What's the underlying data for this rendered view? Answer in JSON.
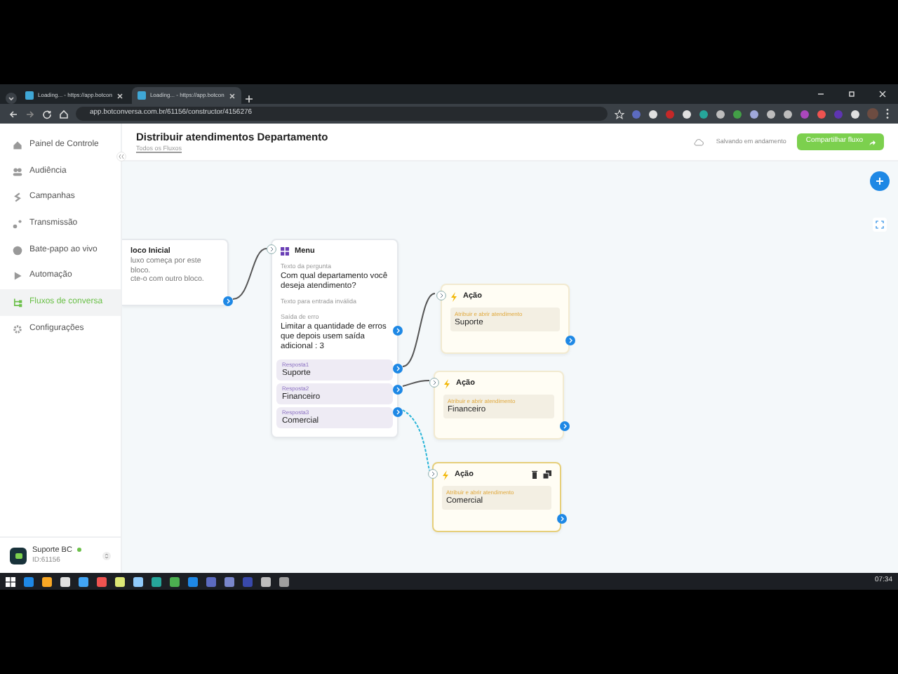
{
  "browser": {
    "tabs": [
      {
        "title": "Loading... - https://app.botcon",
        "selected": false
      },
      {
        "title": "Loading... - https://app.botcon",
        "selected": true
      }
    ],
    "url": "app.botconversa.com.br/61156/constructor/4156276"
  },
  "sidebar": {
    "items": [
      {
        "label": "Painel de Controle",
        "selected": false
      },
      {
        "label": "Audiência",
        "selected": false
      },
      {
        "label": "Campanhas",
        "selected": false
      },
      {
        "label": "Transmissão",
        "selected": false
      },
      {
        "label": "Bate-papo ao vivo",
        "selected": false
      },
      {
        "label": "Automação",
        "selected": false
      },
      {
        "label": "Fluxos de conversa",
        "selected": true
      },
      {
        "label": "Configurações",
        "selected": false
      }
    ],
    "account": {
      "name": "Suporte BC",
      "id": "ID:61156",
      "online": true
    }
  },
  "header": {
    "title": "Distribuir atendimentos Departamento",
    "breadcrumb": "Todos os Fluxos",
    "save_status": "Salvando em andamento",
    "share_button": "Compartilhar fluxo"
  },
  "canvas": {
    "nodes": [
      {
        "kind": "start",
        "title": "loco Inicial",
        "lines": [
          "luxo começa por este bloco.",
          "cte-o com outro bloco."
        ]
      },
      {
        "kind": "menu",
        "title": "Menu",
        "fields": [
          {
            "label": "Texto da pergunta",
            "value": "Com qual departamento você deseja atendimento?"
          },
          {
            "label": "Texto para entrada inválida"
          },
          {
            "label": "Saída de erro",
            "value": "Limitar a quantidade de erros que depois usem saída adicional : 3"
          }
        ],
        "answers": [
          {
            "label": "Resposta1",
            "value": "Suporte"
          },
          {
            "label": "Resposta2",
            "value": "Financeiro"
          },
          {
            "label": "Resposta3",
            "value": "Comercial"
          }
        ]
      },
      {
        "kind": "action",
        "title": "Ação",
        "field_label": "Atribuir e abrir atendimento",
        "value": "Suporte",
        "selected": false
      },
      {
        "kind": "action",
        "title": "Ação",
        "field_label": "Atribuir e abrir atendimento",
        "value": "Financeiro",
        "selected": false
      },
      {
        "kind": "action",
        "title": "Ação",
        "field_label": "Atribuir e abrir atendimento",
        "value": "Comercial",
        "selected": true
      }
    ]
  },
  "taskbar": {
    "time": "07:34"
  }
}
